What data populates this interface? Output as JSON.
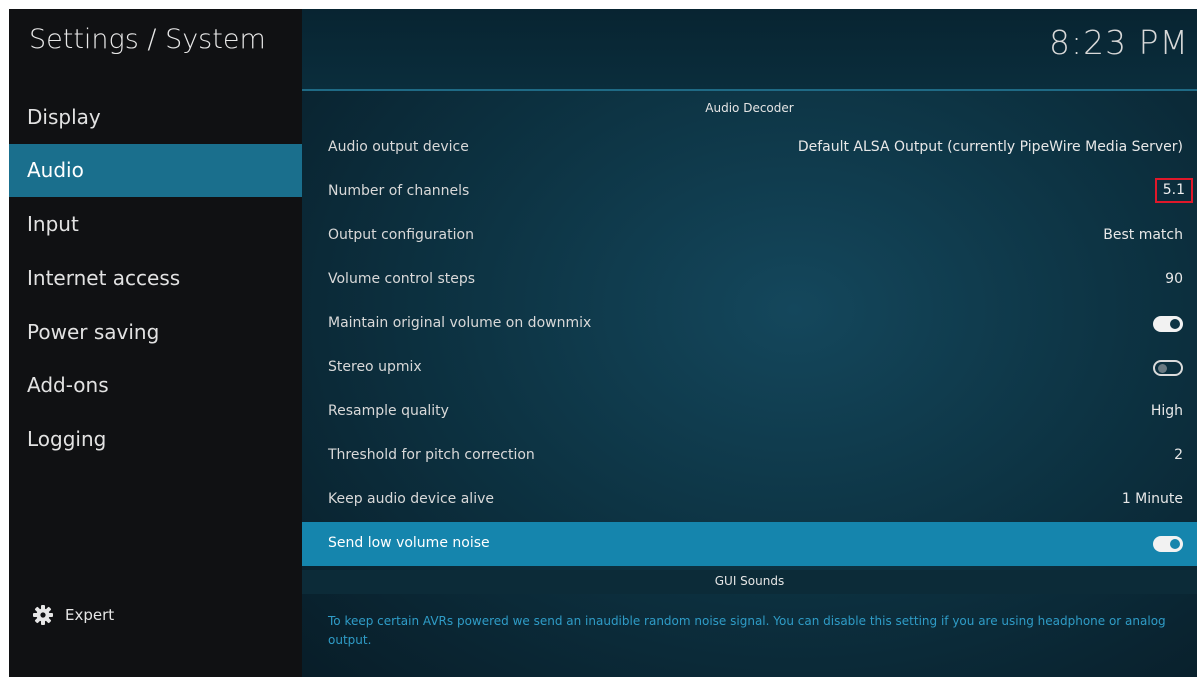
{
  "sidebar": {
    "title": "Settings / System",
    "items": [
      {
        "label": "Display"
      },
      {
        "label": "Audio"
      },
      {
        "label": "Input"
      },
      {
        "label": "Internet access"
      },
      {
        "label": "Power saving"
      },
      {
        "label": "Add-ons"
      },
      {
        "label": "Logging"
      }
    ],
    "active_index": 1,
    "expert_label": "Expert"
  },
  "header": {
    "clock": "8:23 PM"
  },
  "main": {
    "section_audio_decoder": "Audio Decoder",
    "rows": [
      {
        "label": "Audio output device",
        "value": "Default ALSA Output (currently PipeWire Media Server)"
      },
      {
        "label": "Number of channels",
        "value": "5.1"
      },
      {
        "label": "Output configuration",
        "value": "Best match"
      },
      {
        "label": "Volume control steps",
        "value": "90"
      },
      {
        "label": "Maintain original volume on downmix",
        "toggle": "on"
      },
      {
        "label": "Stereo upmix",
        "toggle": "off"
      },
      {
        "label": "Resample quality",
        "value": "High"
      },
      {
        "label": "Threshold for pitch correction",
        "value": "2"
      },
      {
        "label": "Keep audio device alive",
        "value": "1 Minute"
      },
      {
        "label": "Send low volume noise",
        "toggle": "on",
        "focused": true
      }
    ],
    "section_gui_sounds": "GUI Sounds",
    "description": "To keep certain AVRs powered we send an inaudible random noise signal. You can disable this setting if you are using headphone or analog output."
  },
  "colors": {
    "accent": "#1a6f8d",
    "focus_row": "#1585ad",
    "highlight_box": "#e0182a",
    "description_text": "#2f9cc7"
  }
}
